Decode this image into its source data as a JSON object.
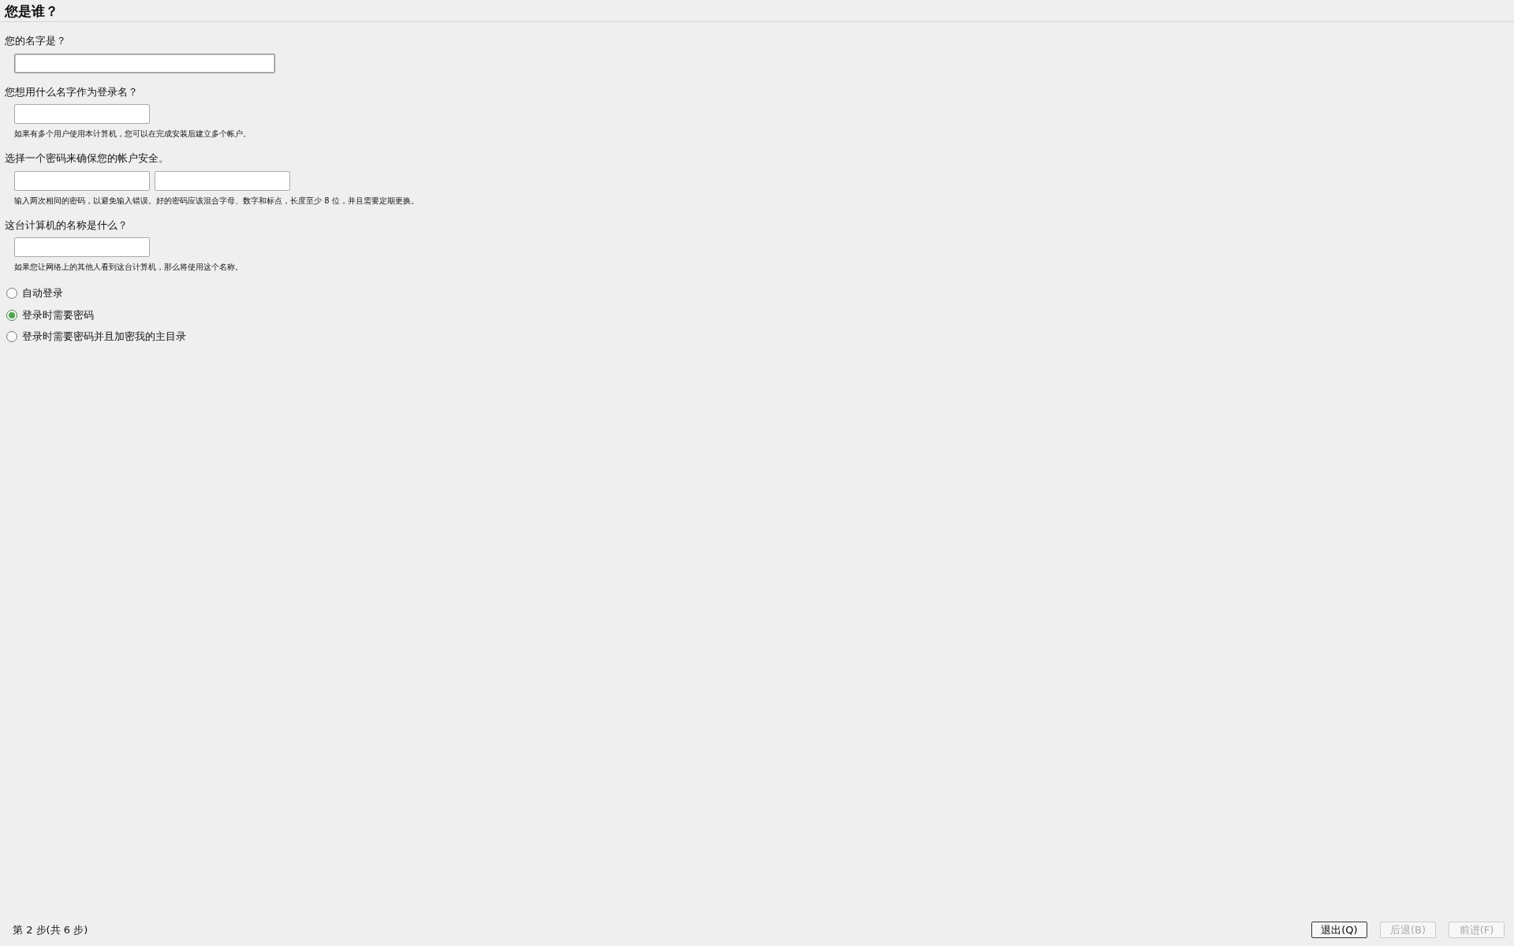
{
  "title": "您是谁？",
  "fields": [
    {
      "label": "您的名字是？",
      "inputs": [
        {
          "kind": "wide",
          "focused": true
        }
      ]
    },
    {
      "label": "您想用什么名字作为登录名？",
      "inputs": [
        {
          "kind": "narrow",
          "focused": false
        }
      ],
      "hint": "如果有多个用户使用本计算机，您可以在完成安装后建立多个帐户。"
    },
    {
      "label": "选择一个密码来确保您的帐户安全。",
      "inputs": [
        {
          "kind": "narrow",
          "focused": false
        },
        {
          "kind": "narrow",
          "focused": false
        }
      ],
      "hint": "输入两次相同的密码，以避免输入错误。好的密码应该混合字母、数字和标点，长度至少 8 位，并且需要定期更换。"
    },
    {
      "label": "这台计算机的名称是什么？",
      "inputs": [
        {
          "kind": "narrow",
          "focused": false
        }
      ],
      "hint": "如果您让网络上的其他人看到这台计算机，那么将使用这个名称。"
    }
  ],
  "login_options": [
    {
      "label": "自动登录",
      "selected": false
    },
    {
      "label": "登录时需要密码",
      "selected": true
    },
    {
      "label": "登录时需要密码并且加密我的主目录",
      "selected": false
    }
  ],
  "status_bar": {
    "step": "第 2 步(共 6 步)"
  },
  "buttons": [
    {
      "label": "退出(Q)",
      "disabled": false
    },
    {
      "label": "后退(B)",
      "disabled": true
    },
    {
      "label": "前进(F)",
      "disabled": true
    }
  ]
}
